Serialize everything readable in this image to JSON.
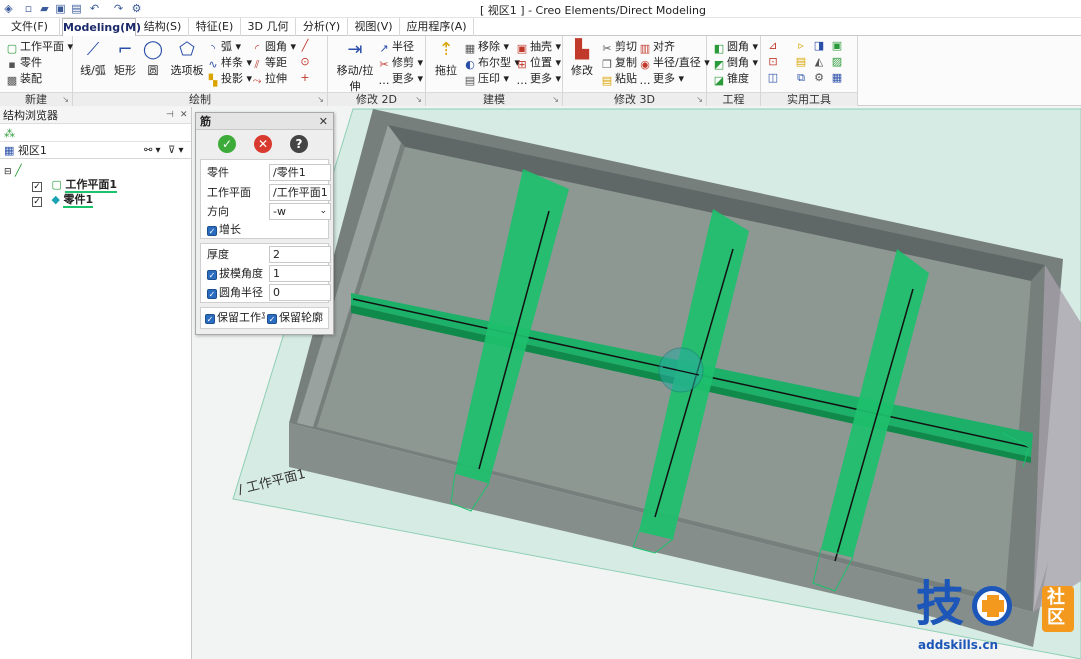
{
  "window": {
    "title": "[ 视区1 ] - Creo Elements/Direct Modeling"
  },
  "tabs": [
    "文件(F)",
    "Modeling(M)",
    "结构(S)",
    "特征(E)",
    "3D 几何",
    "分析(Y)",
    "视图(V)",
    "应用程序(A)"
  ],
  "ribbon": {
    "new_group": {
      "label": "新建",
      "items": [
        "工作平面",
        "零件",
        "装配"
      ]
    },
    "draw_group": {
      "label": "绘制",
      "big": [
        "线/弧",
        "矩形",
        "圆",
        "选项板"
      ],
      "items": [
        "弧",
        "圆角",
        "样条",
        "等距",
        "投影",
        "拉伸"
      ]
    },
    "modify2d_group": {
      "label": "修改 2D",
      "big": [
        "移动/拉伸"
      ],
      "items": [
        "半径",
        "修剪",
        "更多"
      ]
    },
    "model_group": {
      "label": "建模",
      "big": [
        "拖拉"
      ],
      "items": [
        "移除",
        "抽壳",
        "布尔型",
        "位置",
        "压印",
        "更多"
      ]
    },
    "modify3d_group": {
      "label": "修改 3D",
      "big": [
        "修改"
      ],
      "items": [
        "剪切",
        "对齐",
        "复制",
        "半径/直径",
        "粘贴",
        "更多"
      ]
    },
    "eng_group": {
      "label": "工程",
      "items": [
        "圆角",
        "倒角",
        "锥度"
      ]
    },
    "util_group": {
      "label": "实用工具"
    }
  },
  "browser": {
    "title": "结构浏览器",
    "view": "视区1",
    "nodes": [
      "工作平面1",
      "零件1"
    ]
  },
  "dialog": {
    "title": "筋",
    "part_label": "零件",
    "part_value": "/零件1",
    "wp_label": "工作平面",
    "wp_value": "/工作平面1",
    "dir_label": "方向",
    "dir_value": "-w",
    "grow_label": "增长",
    "thick_label": "厚度",
    "thick_value": "2",
    "draft_label": "拔模角度",
    "draft_value": "1",
    "fillet_label": "圆角半径",
    "fillet_value": "0",
    "keep_wp_label": "保留工作平面",
    "keep_profile_label": "保留轮廓"
  },
  "viewport": {
    "wp_label": "/ 工作平面1"
  },
  "watermark": {
    "brand": "技",
    "badge_top": "社",
    "badge_bottom": "区",
    "site": "addskills.cn"
  },
  "colors": {
    "rib": "#19c36a",
    "box_wall": "#7d8684",
    "box_floor": "#8c9a94",
    "plane": "#d6ebe3",
    "accent": "#2a6cc0"
  }
}
